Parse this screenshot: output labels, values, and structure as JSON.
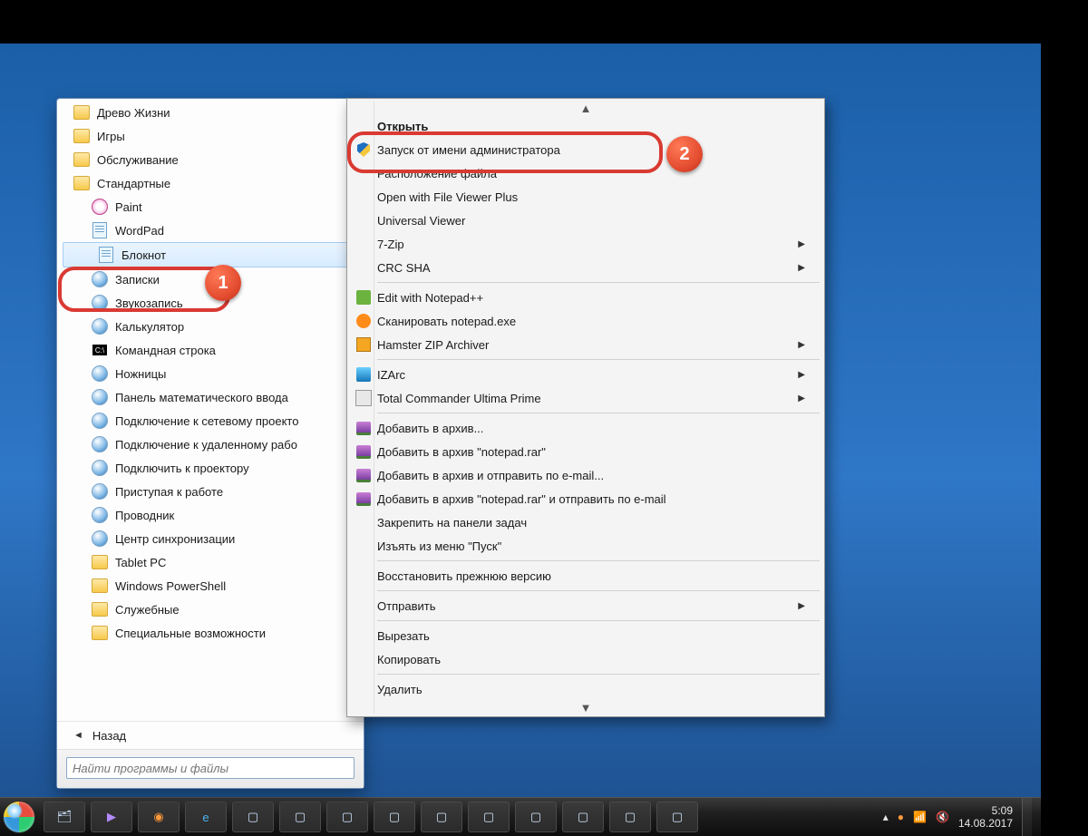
{
  "start_menu": {
    "items": [
      {
        "label": "Древо Жизни",
        "icon": "folder",
        "indent": false
      },
      {
        "label": "Игры",
        "icon": "folder",
        "indent": false
      },
      {
        "label": "Обслуживание",
        "icon": "folder",
        "indent": false
      },
      {
        "label": "Стандартные",
        "icon": "folder",
        "indent": false
      },
      {
        "label": "Paint",
        "icon": "paint",
        "indent": true
      },
      {
        "label": "WordPad",
        "icon": "note",
        "indent": true
      },
      {
        "label": "Блокнот",
        "icon": "note",
        "indent": true,
        "selected": true
      },
      {
        "label": "Записки",
        "icon": "circle",
        "indent": true
      },
      {
        "label": "Звукозапись",
        "icon": "circle",
        "indent": true
      },
      {
        "label": "Калькулятор",
        "icon": "circle",
        "indent": true
      },
      {
        "label": "Командная строка",
        "icon": "cmd",
        "indent": true
      },
      {
        "label": "Ножницы",
        "icon": "circle",
        "indent": true
      },
      {
        "label": "Панель математического ввода",
        "icon": "circle",
        "indent": true
      },
      {
        "label": "Подключение к сетевому проекто",
        "icon": "circle",
        "indent": true
      },
      {
        "label": "Подключение к удаленному рабо",
        "icon": "circle",
        "indent": true
      },
      {
        "label": "Подключить к проектору",
        "icon": "circle",
        "indent": true
      },
      {
        "label": "Приступая к работе",
        "icon": "circle",
        "indent": true
      },
      {
        "label": "Проводник",
        "icon": "circle",
        "indent": true
      },
      {
        "label": "Центр синхронизации",
        "icon": "circle",
        "indent": true
      },
      {
        "label": "Tablet PC",
        "icon": "folder",
        "indent": true
      },
      {
        "label": "Windows PowerShell",
        "icon": "folder",
        "indent": true
      },
      {
        "label": "Служебные",
        "icon": "folder",
        "indent": true
      },
      {
        "label": "Специальные возможности",
        "icon": "folder",
        "indent": true
      }
    ],
    "back_label": "Назад",
    "search_placeholder": "Найти программы и файлы"
  },
  "context_menu": {
    "items": [
      {
        "label": "Открыть",
        "icon": "",
        "bold": true
      },
      {
        "label": "Запуск от имени администратора",
        "icon": "shield"
      },
      {
        "label": "Расположение файла",
        "icon": ""
      },
      {
        "label": "Open with File Viewer Plus",
        "icon": ""
      },
      {
        "label": "Universal Viewer",
        "icon": ""
      },
      {
        "label": "7-Zip",
        "icon": "",
        "submenu": true
      },
      {
        "label": "CRC SHA",
        "icon": "",
        "submenu": true
      },
      {
        "sep": true
      },
      {
        "label": "Edit with Notepad++",
        "icon": "notepadpp"
      },
      {
        "label": "Сканировать notepad.exe",
        "icon": "avast"
      },
      {
        "label": "Hamster ZIP Archiver",
        "icon": "hamster",
        "submenu": true
      },
      {
        "sep": true
      },
      {
        "label": "IZArc",
        "icon": "izarc",
        "submenu": true
      },
      {
        "label": "Total Commander Ultima Prime",
        "icon": "tc",
        "submenu": true
      },
      {
        "sep": true
      },
      {
        "label": "Добавить в архив...",
        "icon": "winrar"
      },
      {
        "label": "Добавить в архив \"notepad.rar\"",
        "icon": "winrar"
      },
      {
        "label": "Добавить в архив и отправить по e-mail...",
        "icon": "winrar"
      },
      {
        "label": "Добавить в архив \"notepad.rar\" и отправить по e-mail",
        "icon": "winrar"
      },
      {
        "label": "Закрепить на панели задач",
        "icon": ""
      },
      {
        "label": "Изъять из меню \"Пуск\"",
        "icon": ""
      },
      {
        "sep": true
      },
      {
        "label": "Восстановить прежнюю версию",
        "icon": ""
      },
      {
        "sep": true
      },
      {
        "label": "Отправить",
        "icon": "",
        "submenu": true
      },
      {
        "sep": true
      },
      {
        "label": "Вырезать",
        "icon": ""
      },
      {
        "label": "Копировать",
        "icon": ""
      },
      {
        "sep": true
      },
      {
        "label": "Удалить",
        "icon": ""
      }
    ]
  },
  "badges": {
    "one": "1",
    "two": "2"
  },
  "tray": {
    "time": "5:09",
    "date": "14.08.2017"
  }
}
